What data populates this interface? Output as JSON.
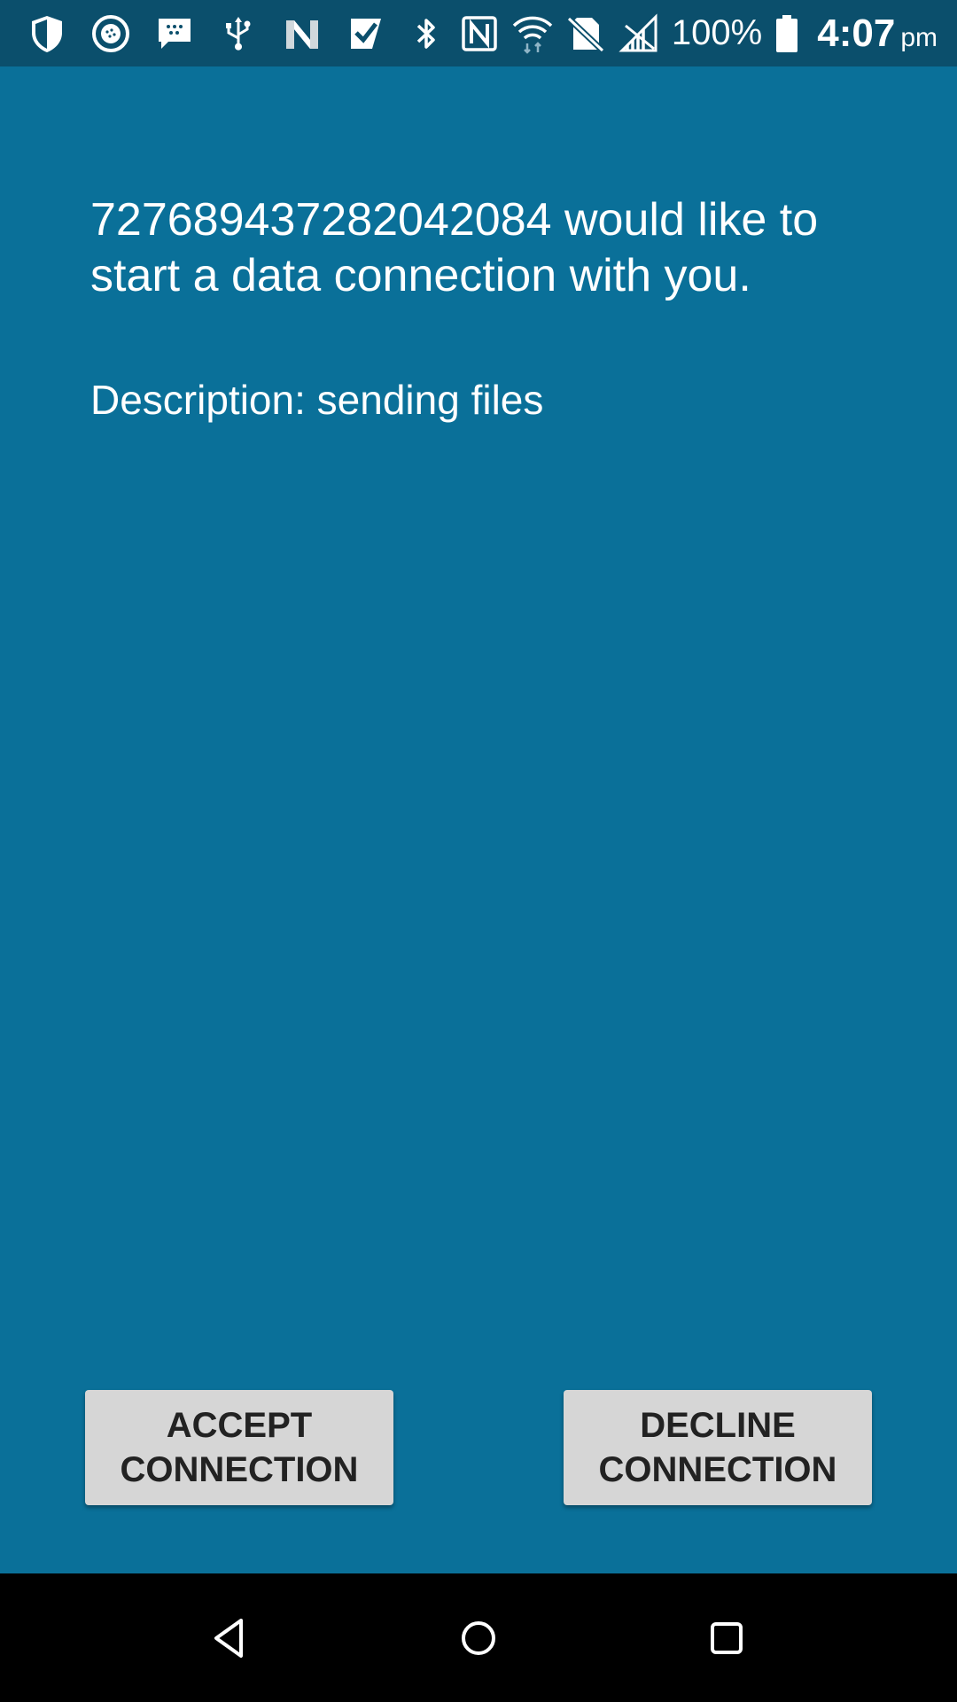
{
  "status_bar": {
    "left_icons": [
      "shield-icon",
      "camera-shutter-icon",
      "bbm-chat-icon",
      "usb-icon",
      "n-app-icon",
      "check-app-icon"
    ],
    "right_icons": [
      "bluetooth-icon",
      "nfc-icon",
      "wifi-icon",
      "no-sim-icon",
      "no-signal-icon",
      "battery-icon"
    ],
    "battery_percent": "100%",
    "time": "4:07",
    "ampm": "pm"
  },
  "dialog": {
    "message": "727689437282042084 would like to start a data connection with you.",
    "description_label": "Description: sending files"
  },
  "buttons": {
    "accept_line1": "ACCEPT",
    "accept_line2": "CONNECTION",
    "decline_line1": "DECLINE",
    "decline_line2": "CONNECTION"
  },
  "nav_bar": {
    "back": "back-icon",
    "home": "home-icon",
    "recents": "recents-icon"
  },
  "colors": {
    "background": "#0a7099",
    "status_bar": "#0b4f6c",
    "button": "#d6d6d6",
    "nav_bar": "#000000"
  }
}
